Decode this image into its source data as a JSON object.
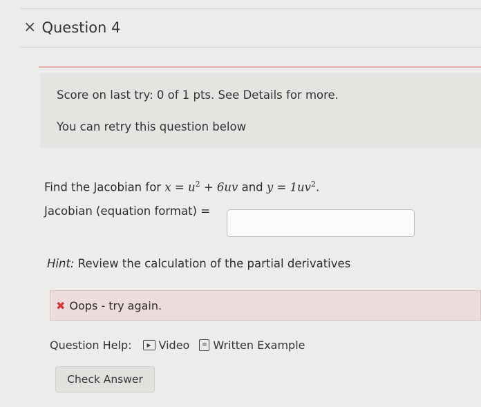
{
  "question": {
    "close_icon": "×",
    "title": "Question 4"
  },
  "score": {
    "last_try": "Score on last try: 0 of 1 pts. See Details for more.",
    "retry": "You can retry this question below"
  },
  "problem": {
    "prefix": "Find the Jacobian for ",
    "x_var": "x",
    "eq1": " = u",
    "eq1_exp": "2",
    "eq1_rest": " + 6uv",
    "middle": " and ",
    "y_var": "y",
    "eq2": " = 1uv",
    "eq2_exp": "2",
    "suffix": ".",
    "jacobian_label": "Jacobian (equation format) =",
    "answer_value": ""
  },
  "hint": {
    "label": "Hint:",
    "text": " Review the calculation of the partial derivatives"
  },
  "feedback": {
    "icon": "✖",
    "text": "Oops - try again."
  },
  "help": {
    "label": "Question Help:",
    "video_label": "Video",
    "written_label": "Written Example"
  },
  "actions": {
    "check_label": "Check Answer"
  },
  "colors": {
    "feedback_red": "#cf3b3b",
    "divider_red": "#e7a9a4"
  }
}
